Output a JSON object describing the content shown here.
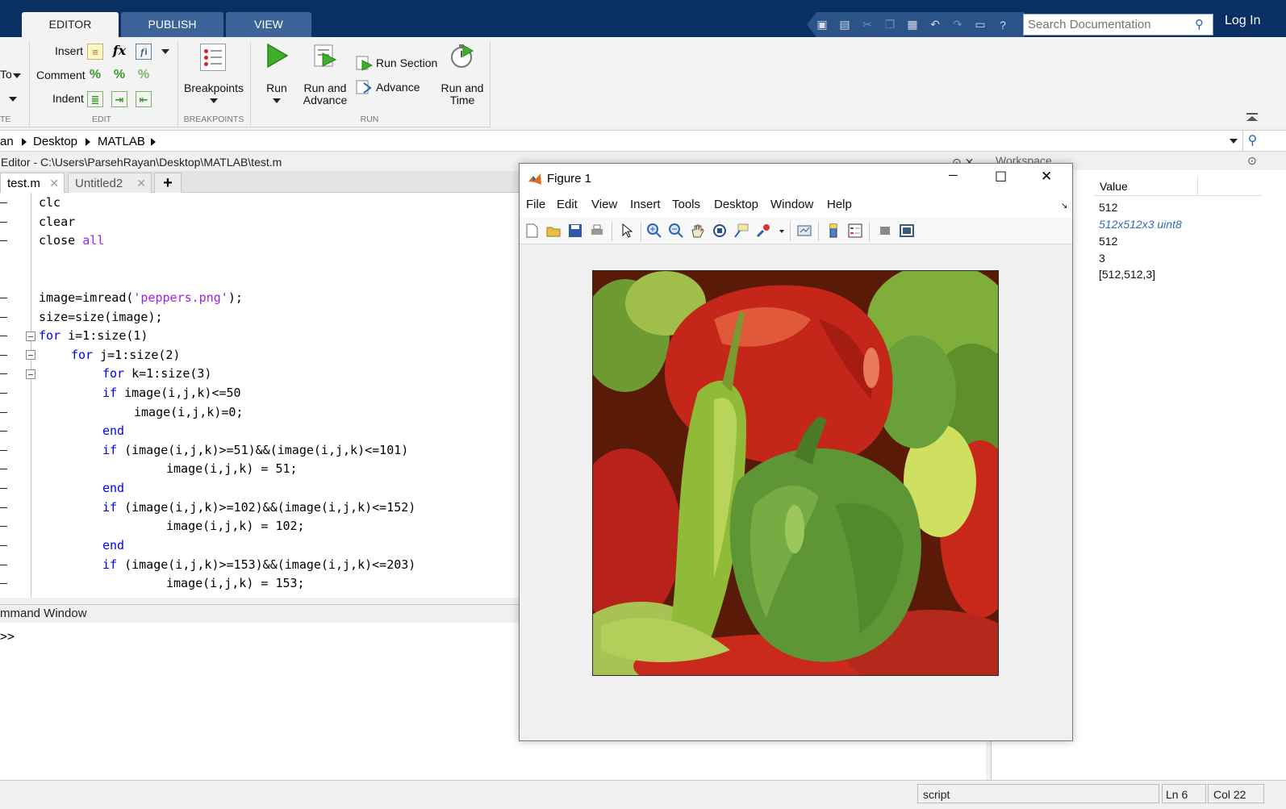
{
  "ribbon": {
    "tabs": [
      "EDITOR",
      "PUBLISH",
      "VIEW"
    ],
    "quick_access_icons": [
      "new-icon",
      "save-icon",
      "cut-icon",
      "copy-icon",
      "paste-icon",
      "undo-icon",
      "redo-icon",
      "switch-windows-icon",
      "help-icon"
    ],
    "search_placeholder": "Search Documentation",
    "login": "Log In",
    "left_cut": {
      "to": "To",
      "te": "TE"
    },
    "edit": {
      "insert": "Insert",
      "comment": "Comment",
      "indent": "Indent",
      "fx": "fx",
      "group": "EDIT"
    },
    "breakpoints": {
      "label": "Breakpoints",
      "group": "BREAKPOINTS"
    },
    "run": {
      "run": "Run",
      "run_and_advance_1": "Run and",
      "run_and_advance_2": "Advance",
      "run_section": "Run Section",
      "advance": "Advance",
      "run_and_time_1": "Run and",
      "run_and_time_2": "Time",
      "group": "RUN"
    }
  },
  "address": {
    "crumbs": [
      "an",
      "Desktop",
      "MATLAB"
    ]
  },
  "editor": {
    "title": "Editor - C:\\Users\\ParsehRayan\\Desktop\\MATLAB\\test.m",
    "tabs": [
      "test.m",
      "Untitled2"
    ],
    "add_tab": "+",
    "tab_close": "✕",
    "panel_controls": "⊙ ✕"
  },
  "code": {
    "l1": "clc",
    "l2": "clear",
    "l3a": "close ",
    "l3b": "all",
    "l4a": "image=imread(",
    "l4b": "'peppers.png'",
    "l4c": ");",
    "l5": "size=size(image);",
    "l6a": "for",
    "l6b": " i=1:size(1)",
    "l7a": "for",
    "l7b": " j=1:size(2)",
    "l8a": "for",
    "l8b": " k=1:size(3)",
    "l9a": "if",
    "l9b": " image(i,j,k)<=50",
    "l10": "image(i,j,k)=0;",
    "l11": "end",
    "l12a": "if",
    "l12b": " (image(i,j,k)>=51)&&(image(i,j,k)<=101)",
    "l13": "image(i,j,k) = 51;",
    "l14": "end",
    "l15a": "if",
    "l15b": " (image(i,j,k)>=102)&&(image(i,j,k)<=152)",
    "l16": "image(i,j,k) = 102;",
    "l17": "end",
    "l18a": "if",
    "l18b": " (image(i,j,k)>=153)&&(image(i,j,k)<=203)",
    "l19": "image(i,j,k) = 153;"
  },
  "command_window": {
    "title": "mmand Window",
    "prompt": ">>"
  },
  "workspace": {
    "title": "Workspace",
    "value_header": "Value",
    "values": [
      "512",
      "512x512x3 uint8",
      "512",
      "3",
      "[512,512,3]"
    ]
  },
  "status": {
    "mode": "script",
    "ln": "Ln  6",
    "col": "Col  22"
  },
  "figure": {
    "title": "Figure 1",
    "menu": [
      "File",
      "Edit",
      "View",
      "Insert",
      "Tools",
      "Desktop",
      "Window",
      "Help"
    ],
    "toolbar_icons": [
      "new-figure-icon",
      "open-file-icon",
      "save-figure-icon",
      "print-figure-icon",
      "edit-plot-icon",
      "zoom-in-icon",
      "zoom-out-icon",
      "pan-icon",
      "rotate-3d-icon",
      "data-cursor-icon",
      "brush-icon",
      "link-plot-icon",
      "colorbar-icon",
      "legend-icon",
      "hide-plot-tools-icon",
      "show-plot-tools-icon"
    ],
    "window_controls": [
      "─",
      "☐",
      "✕"
    ]
  },
  "colors": {
    "titlebar": "#0a2f63",
    "keyword": "#0000ff",
    "string": "#a020f0",
    "workspace_link": "#2f6db3"
  }
}
